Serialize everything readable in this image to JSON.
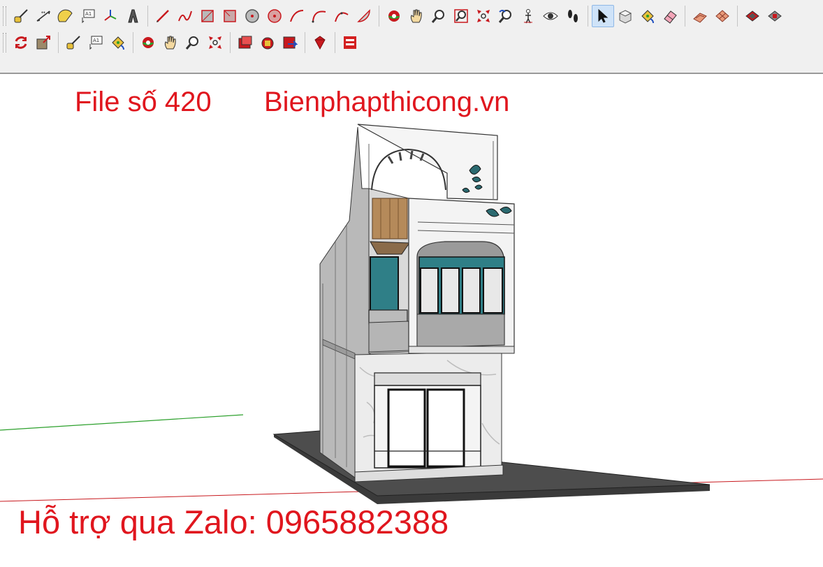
{
  "app": {
    "name": "SketchUp 3D model viewport"
  },
  "toolbar": {
    "row1": [
      {
        "name": "tape-measure-icon"
      },
      {
        "name": "dimension-icon"
      },
      {
        "name": "protractor-icon"
      },
      {
        "name": "text-icon"
      },
      {
        "name": "axes-icon"
      },
      {
        "name": "3d-text-icon"
      },
      {
        "sep": true
      },
      {
        "name": "pencil-line-icon"
      },
      {
        "name": "freehand-icon"
      },
      {
        "name": "rectangle-icon"
      },
      {
        "name": "rotated-rectangle-icon"
      },
      {
        "name": "circle-icon"
      },
      {
        "name": "polygon-icon"
      },
      {
        "name": "arc-icon"
      },
      {
        "name": "2-point-arc-icon"
      },
      {
        "name": "3-point-arc-icon"
      },
      {
        "name": "pie-icon"
      },
      {
        "sep": true
      },
      {
        "name": "orbit-icon"
      },
      {
        "name": "pan-icon"
      },
      {
        "name": "zoom-icon"
      },
      {
        "name": "zoom-window-icon"
      },
      {
        "name": "zoom-extents-icon"
      },
      {
        "name": "previous-view-icon"
      },
      {
        "name": "position-camera-icon"
      },
      {
        "name": "look-around-icon"
      },
      {
        "name": "walk-icon"
      },
      {
        "sep": true
      },
      {
        "name": "select-icon",
        "active": true
      },
      {
        "name": "make-component-icon"
      },
      {
        "name": "paint-bucket-icon"
      },
      {
        "name": "eraser-icon"
      },
      {
        "sep": true
      },
      {
        "name": "sandbox-from-contours-icon"
      },
      {
        "name": "sandbox-from-scratch-icon"
      },
      {
        "sep": true
      },
      {
        "name": "3d-warehouse-icon"
      },
      {
        "name": "extension-warehouse-icon"
      }
    ],
    "row2": [
      {
        "name": "rotate-icon"
      },
      {
        "name": "scale-icon"
      },
      {
        "sep": true
      },
      {
        "name": "tape-measure-icon"
      },
      {
        "name": "text-icon"
      },
      {
        "name": "paint-bucket-icon"
      },
      {
        "sep": true
      },
      {
        "name": "orbit-icon"
      },
      {
        "name": "pan-icon"
      },
      {
        "name": "zoom-icon"
      },
      {
        "name": "zoom-extents-icon"
      },
      {
        "sep": true
      },
      {
        "name": "get-models-icon"
      },
      {
        "name": "share-component-icon"
      },
      {
        "name": "share-model-icon"
      },
      {
        "sep": true
      },
      {
        "name": "ruby-console-icon"
      },
      {
        "sep": true
      },
      {
        "name": "layout-icon"
      }
    ]
  },
  "overlay": {
    "file_label": "File số 420",
    "site_label": "Bienphapthicong.vn",
    "zalo_label": "Hỗ trợ qua Zalo: 0965882388"
  },
  "colors": {
    "overlay_text": "#e0161e",
    "green_axis": "#2ca02c",
    "red_axis": "#c8191e",
    "toolbar_bg": "#f0f0f0",
    "glass": "#2f7f87",
    "wood": "#b58a5a",
    "ground": "#4b4b4b"
  }
}
